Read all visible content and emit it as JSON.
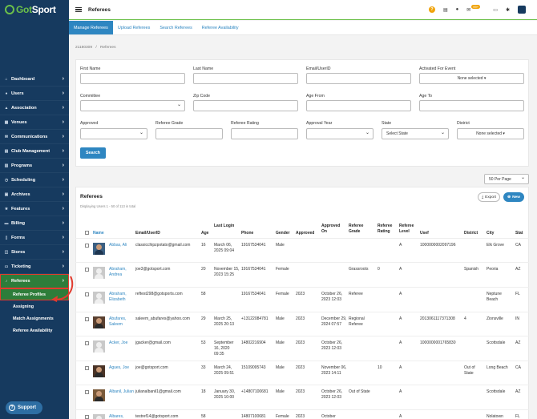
{
  "app": {
    "logo_pre": "Got",
    "logo_post": "Sport",
    "page_title": "Referees",
    "mail_badge": "99+"
  },
  "sidebar": {
    "items": [
      {
        "label": "Dashboard",
        "icon": "home-icon",
        "glyph": "⌂"
      },
      {
        "label": "Users",
        "icon": "user-icon",
        "glyph": "●"
      },
      {
        "label": "Association",
        "icon": "sitemap-icon",
        "glyph": "▲"
      },
      {
        "label": "Venues",
        "icon": "building-icon",
        "glyph": "▦"
      },
      {
        "label": "Communications",
        "icon": "chat-icon",
        "glyph": "✉"
      },
      {
        "label": "Club Management",
        "icon": "clipboard-icon",
        "glyph": "▤"
      },
      {
        "label": "Programs",
        "icon": "book-icon",
        "glyph": "▥"
      },
      {
        "label": "Scheduling",
        "icon": "calendar-icon",
        "glyph": "◷"
      },
      {
        "label": "Archives",
        "icon": "archive-icon",
        "glyph": "▣"
      },
      {
        "label": "Features",
        "icon": "star-icon",
        "glyph": "★"
      },
      {
        "label": "Billing",
        "icon": "wallet-icon",
        "glyph": "▬"
      },
      {
        "label": "Forms",
        "icon": "file-icon",
        "glyph": "▯"
      },
      {
        "label": "Stores",
        "icon": "cart-icon",
        "glyph": "◫"
      },
      {
        "label": "Ticketing",
        "icon": "ticket-icon",
        "glyph": "▭"
      },
      {
        "label": "Referees",
        "icon": "whistle-icon",
        "glyph": "♪"
      }
    ],
    "sub_items": [
      "Referee Profiles",
      "Assigning",
      "Match Assignments",
      "Referee Availability"
    ],
    "support": "Support"
  },
  "tabs": [
    "Manage Referees",
    "Upload Referees",
    "Search Referees",
    "Referee Availability"
  ],
  "breadcrumb": {
    "id": "21180309",
    "sep": "/",
    "page": "Referees"
  },
  "filters": {
    "first_name": "First Name",
    "last_name": "Last Name",
    "email": "Email/UserID",
    "activated": "Activated For Event",
    "activated_value": "None selected",
    "committee": "Committee",
    "zip": "Zip Code",
    "age_from": "Age From",
    "age_to": "Age To",
    "approved": "Approved",
    "grade": "Referee Grade",
    "rating": "Referee Rating",
    "approval_year": "Approval Year",
    "state": "State",
    "state_value": "Select State",
    "district": "District",
    "district_value": "None selected",
    "search": "Search"
  },
  "per_page": "50 Per Page",
  "list": {
    "title": "Referees",
    "subtitle": "Displaying Users 1 - 50 of 113 in total",
    "export": "Export",
    "new": "New",
    "headers": {
      "name": "Name",
      "email": "Email/UserID",
      "age": "Age",
      "last_login": "Last Login",
      "phone": "Phone",
      "gender": "Gender",
      "approved": "Approved",
      "approved_on": "Approved On",
      "grade": "Referee Grade",
      "rating": "Referee Rating",
      "level": "Referee Level",
      "usef": "Usef",
      "district": "District",
      "city": "City",
      "state": "Stat"
    },
    "rows": [
      {
        "name": "Abbas, Ali",
        "email": "classicchipzpotato@gmail.com",
        "age": "16",
        "login": "March 06, 2025 09:04",
        "phone": "19167534041",
        "gender": "Male",
        "approved": "",
        "approved_on": "",
        "grade": "",
        "rating": "",
        "level": "A",
        "usef": "1000000002097196",
        "district": "",
        "city": "Elk Grove",
        "state": "CA"
      },
      {
        "name": "Abraham, Andrea",
        "email": "joe3@gotsport.com",
        "age": "20",
        "login": "November 15, 2023 15:25",
        "phone": "19167534041",
        "gender": "Female",
        "approved": "",
        "approved_on": "",
        "grade": "Grassroots",
        "rating": "0",
        "level": "A",
        "usef": "",
        "district": "Spanish",
        "city": "Peoria",
        "state": "AZ"
      },
      {
        "name": "Abraham, Elizabeth",
        "email": "reftest298@gotsports.com",
        "age": "58",
        "login": "",
        "phone": "19167534041",
        "gender": "Female",
        "approved": "2023",
        "approved_on": "October 26, 2023 12:03",
        "grade": "Referee",
        "rating": "",
        "level": "A",
        "usef": "",
        "district": "",
        "city": "Neptune Beach",
        "state": "FL"
      },
      {
        "name": "Abufares, Saleem",
        "email": "saleem_abufares@yahoo.com",
        "age": "29",
        "login": "March 25, 2025 20:13",
        "phone": "+13122084781",
        "gender": "Male",
        "approved": "2023",
        "approved_on": "December 29, 2024 07:57",
        "grade": "Regional Referee",
        "rating": "",
        "level": "A",
        "usef": "2013061117371308",
        "district": "4",
        "city": "Zionsville",
        "state": "IN"
      },
      {
        "name": "Acker, Joe",
        "email": "jgacker@gmail.com",
        "age": "53",
        "login": "September 16, 2020 09:35",
        "phone": "14802216904",
        "gender": "Male",
        "approved": "2023",
        "approved_on": "October 26, 2023 12:03",
        "grade": "",
        "rating": "",
        "level": "A",
        "usef": "1000000001765830",
        "district": "",
        "city": "Scottsdale",
        "state": "AZ"
      },
      {
        "name": "Agues, Joe",
        "email": "joe@gotsport.com",
        "age": "33",
        "login": "March 24, 2025 09:51",
        "phone": "15109095743",
        "gender": "Male",
        "approved": "2023",
        "approved_on": "November 06, 2023 14:11",
        "grade": "",
        "rating": "10",
        "level": "A",
        "usef": "",
        "district": "Out of State",
        "city": "Long Beach",
        "state": "CA"
      },
      {
        "name": "Albanil, Julian",
        "email": "julianalbanil1@gmail.com",
        "age": "18",
        "login": "January 30, 2025 10:00",
        "phone": "+14807100681",
        "gender": "Male",
        "approved": "2023",
        "approved_on": "October 26, 2023 12:03",
        "grade": "Out of State",
        "rating": "",
        "level": "A",
        "usef": "",
        "district": "",
        "city": "Scottsdale",
        "state": "AZ"
      },
      {
        "name": "Albares,",
        "email": "testref14@gotsport.com",
        "age": "58",
        "login": "",
        "phone": "14807100681",
        "gender": "Female",
        "approved": "2023",
        "approved_on": "October",
        "grade": "",
        "rating": "",
        "level": "A",
        "usef": "",
        "district": "",
        "city": "Nolatown",
        "state": "FL"
      }
    ]
  }
}
